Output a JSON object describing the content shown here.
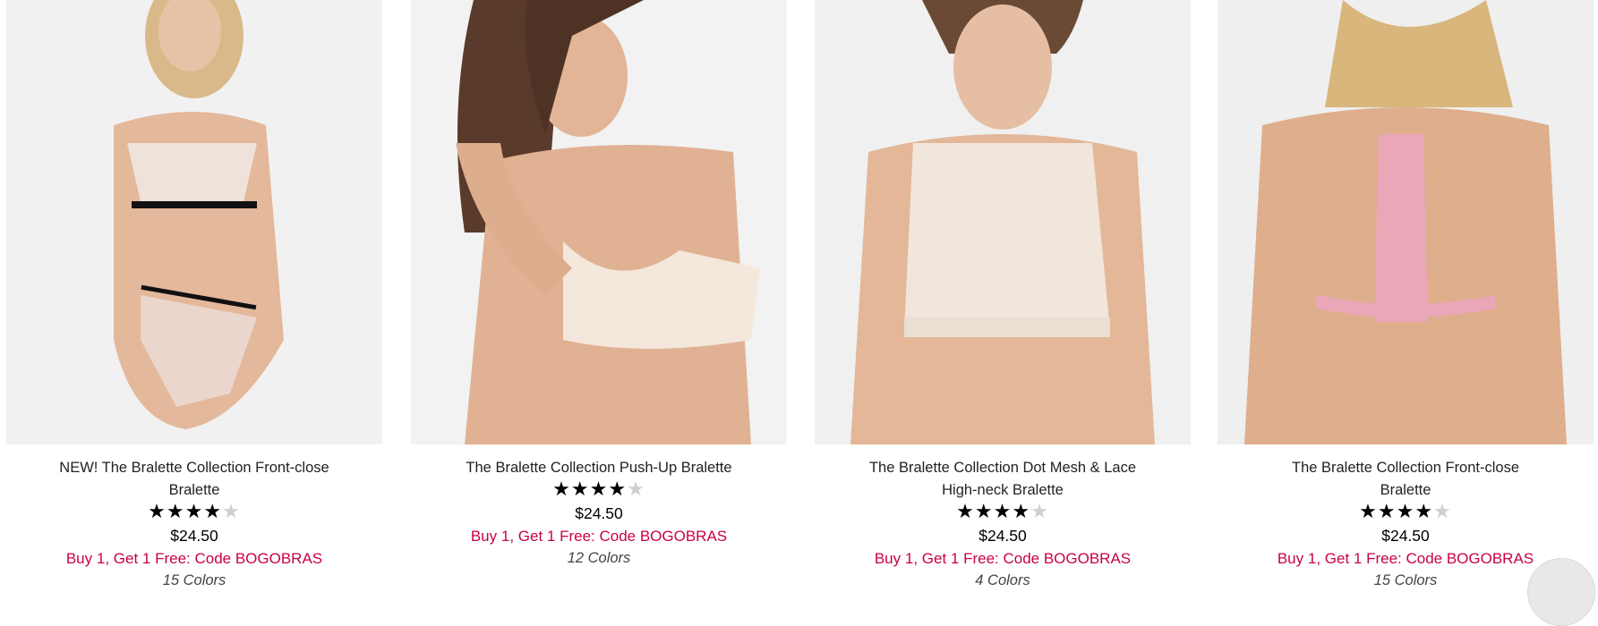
{
  "products": [
    {
      "name_line1": "NEW! The Bralette Collection Front-close",
      "name_line2": "Bralette",
      "rating": 4,
      "price": "$24.50",
      "promo": "Buy 1, Get 1 Free: Code BOGOBRAS",
      "colors": "15 Colors",
      "image_icon": "model-photo-icon",
      "accent": "#efe2da"
    },
    {
      "name_line1": "The Bralette Collection Push-Up Bralette",
      "name_line2": "",
      "rating": 4,
      "price": "$24.50",
      "promo": "Buy 1, Get 1 Free: Code BOGOBRAS",
      "colors": "12 Colors",
      "image_icon": "model-photo-icon",
      "accent": "#f4e7dc"
    },
    {
      "name_line1": "The Bralette Collection Dot Mesh & Lace",
      "name_line2": "High-neck Bralette",
      "rating": 4,
      "price": "$24.50",
      "promo": "Buy 1, Get 1 Free: Code BOGOBRAS",
      "colors": "4 Colors",
      "image_icon": "model-photo-icon",
      "accent": "#f1e8de"
    },
    {
      "name_line1": "The Bralette Collection Front-close",
      "name_line2": "Bralette",
      "rating": 4,
      "price": "$24.50",
      "promo": "Buy 1, Get 1 Free: Code BOGOBRAS",
      "colors": "15 Colors",
      "image_icon": "model-photo-icon",
      "accent": "#e9a7b8"
    }
  ],
  "colors": {
    "promo": "#c8004a",
    "star_on": "#000000",
    "star_off": "#cfcfcf",
    "photo_bg": "#eeeeee",
    "skin": "#e4b89a"
  },
  "scroll_button_icon": "back-to-top-icon"
}
